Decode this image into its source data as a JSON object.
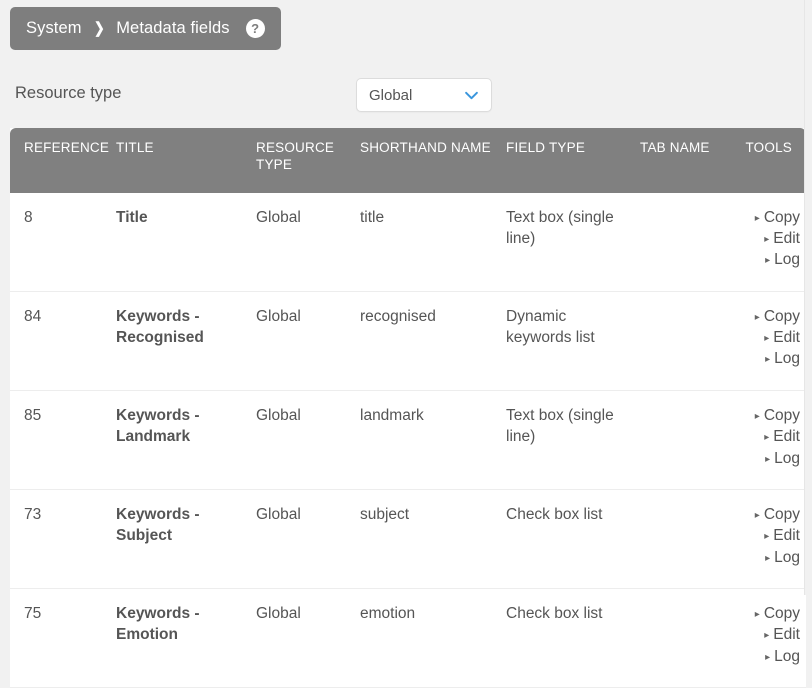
{
  "header": {
    "crumb_root": "System",
    "crumb_separator": "❯",
    "crumb_current": "Metadata fields",
    "help_glyph": "?"
  },
  "filter": {
    "label": "Resource type",
    "selected": "Global",
    "chevron_color": "#3a96dd"
  },
  "table": {
    "columns": [
      "REFERENCE",
      "TITLE",
      "RESOURCE TYPE",
      "SHORTHAND NAME",
      "FIELD TYPE",
      "TAB NAME",
      "TOOLS"
    ],
    "tool_labels": [
      "Copy",
      "Edit",
      "Log"
    ],
    "tool_bullet": "▸",
    "rows": [
      {
        "reference": "8",
        "title": "Title",
        "resource_type": "Global",
        "shorthand_name": "title",
        "field_type": "Text box (single line)",
        "tab_name": ""
      },
      {
        "reference": "84",
        "title": "Keywords - Recognised",
        "resource_type": "Global",
        "shorthand_name": "recognised",
        "field_type": "Dynamic keywords list",
        "tab_name": ""
      },
      {
        "reference": "85",
        "title": "Keywords - Landmark",
        "resource_type": "Global",
        "shorthand_name": "landmark",
        "field_type": "Text box (single line)",
        "tab_name": ""
      },
      {
        "reference": "73",
        "title": "Keywords - Subject",
        "resource_type": "Global",
        "shorthand_name": "subject",
        "field_type": "Check box list",
        "tab_name": ""
      },
      {
        "reference": "75",
        "title": "Keywords - Emotion",
        "resource_type": "Global",
        "shorthand_name": "emotion",
        "field_type": "Check box list",
        "tab_name": ""
      }
    ]
  },
  "colors": {
    "page_background": "#f1f1f1",
    "breadcrumb_background": "#7e7e7e",
    "table_header_background": "#808080",
    "text": "#555555",
    "accent": "#3a96dd"
  }
}
